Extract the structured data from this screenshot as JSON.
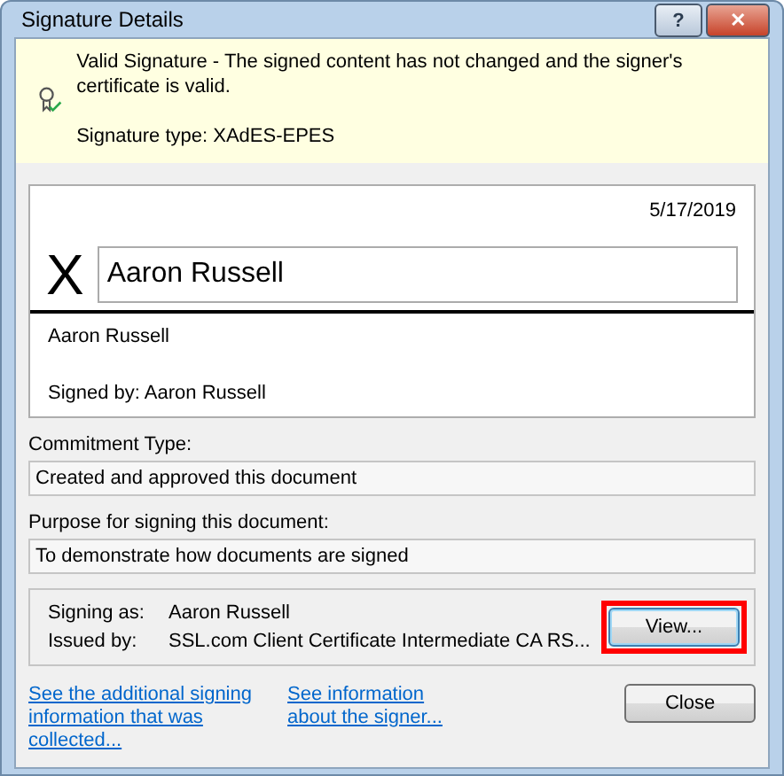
{
  "window": {
    "title": "Signature Details",
    "buttons": [
      {
        "kind": "help",
        "label": "?"
      },
      {
        "kind": "close",
        "label": "✕"
      }
    ]
  },
  "banner": {
    "message": "Valid Signature - The signed content has not changed and the signer's certificate is valid.",
    "signature_type": "Signature type: XAdES-EPES"
  },
  "signature": {
    "date": "5/17/2019",
    "mark": "X",
    "signed_name": "Aaron Russell",
    "signer_line": "Aaron Russell",
    "signed_by": "Signed by: Aaron Russell"
  },
  "commitment": {
    "label": "Commitment Type:",
    "value": "Created and approved this document"
  },
  "purpose": {
    "label": "Purpose for signing this document:",
    "value": "To demonstrate how documents are signed"
  },
  "certificate": {
    "rows": [
      {
        "label": "Signing as:",
        "value": "Aaron Russell"
      },
      {
        "label": "Issued by:",
        "value": "SSL.com Client Certificate Intermediate CA RS..."
      }
    ],
    "view_button": {
      "label": "View...",
      "highlighted": true
    }
  },
  "links": [
    "See the additional signing information that was collected...",
    "See information about the signer..."
  ],
  "close_button": "Close"
}
